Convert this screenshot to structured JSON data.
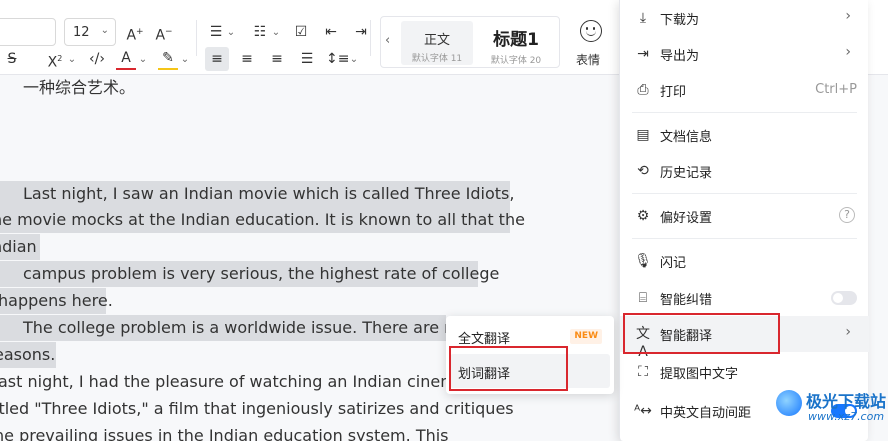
{
  "toolbar": {
    "font_size": "12",
    "style_normal_title": "正文",
    "style_normal_sub": "默认字体 11",
    "style_h1_title": "标题1",
    "style_h1_sub": "默认字体 20",
    "emoji_label": "表情",
    "icons": [
      "font-size-increase-icon",
      "font-size-decrease-icon",
      "bullet-list-icon",
      "numbered-list-icon",
      "checkbox-list-icon",
      "outdent-icon",
      "indent-icon",
      "strikethrough-icon",
      "superscript-icon",
      "code-icon",
      "font-color-icon",
      "highlight-icon",
      "align-left-icon",
      "align-center-icon",
      "align-right-icon",
      "justify-icon",
      "line-spacing-icon",
      "emoji-icon"
    ],
    "font_color": "#d9272e",
    "highlight_color": "#f5c518"
  },
  "document": {
    "lines": [
      {
        "text": "一种综合艺术。",
        "selected": false
      },
      {
        "text": "Last night, I saw an Indian movie which is called Three Idiots,",
        "selected": true
      },
      {
        "text": "he movie mocks at the Indian education. It is known to all that the",
        "selected": true
      },
      {
        "text": "ndian",
        "selected": true
      },
      {
        "text": "campus problem is very serious, the highest rate of college",
        "selected": true
      },
      {
        "text": "happens here.",
        "selected": true
      },
      {
        "text": "The college problem is a worldwide issue. There are ma",
        "selected": true
      },
      {
        "text": "easons.",
        "selected": true
      },
      {
        "text": "ast night, I had the pleasure of watching an Indian cinema",
        "selected": false
      },
      {
        "text": "itled \"Three Idiots,\" a film that ingeniously satirizes and critiques",
        "selected": false
      },
      {
        "text": "he prevailing issues in the Indian education system. This",
        "selected": false
      }
    ]
  },
  "main_menu": {
    "items": [
      {
        "label": "下载为",
        "icon": "download-icon",
        "arrow": true
      },
      {
        "label": "导出为",
        "icon": "export-icon",
        "arrow": true
      },
      {
        "label": "打印",
        "icon": "printer-icon",
        "shortcut": "Ctrl+P"
      },
      {
        "label": "文档信息",
        "icon": "document-info-icon"
      },
      {
        "label": "历史记录",
        "icon": "history-icon"
      },
      {
        "label": "偏好设置",
        "icon": "preferences-icon",
        "help": "?"
      },
      {
        "label": "闪记",
        "icon": "flash-note-icon"
      },
      {
        "label": "智能纠错",
        "icon": "ai-proofread-icon",
        "toggle": false
      },
      {
        "label": "智能翻译",
        "icon": "ai-translate-icon",
        "arrow": true,
        "active": true
      },
      {
        "label": "提取图中文字",
        "icon": "ocr-icon"
      },
      {
        "label": "中英文自动间距",
        "icon": "auto-spacing-icon",
        "toggle": true
      }
    ]
  },
  "submenu": {
    "items": [
      {
        "label": "全文翻译",
        "badge": "NEW"
      },
      {
        "label": "划词翻译",
        "hover": true
      }
    ]
  },
  "watermark": {
    "name": "极光下载站",
    "url": "www.xz7.com"
  },
  "colors": {
    "accent": "#1677ff",
    "highlight_border": "#d9272e",
    "selection": "#dadce0"
  }
}
